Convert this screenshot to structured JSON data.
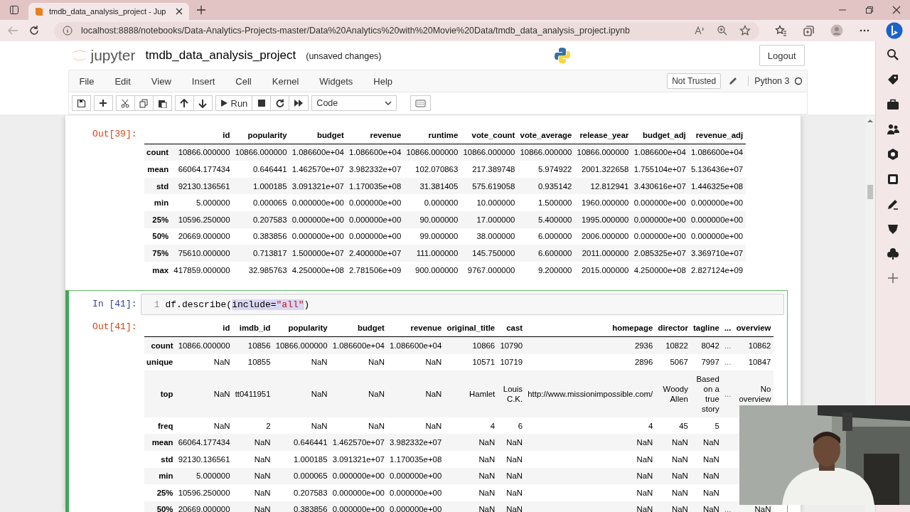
{
  "browser": {
    "tab_title": "tmdb_data_analysis_project - Jup",
    "url": "localhost:8888/notebooks/Data-Analytics-Projects-master/Data%20Analytics%20with%20Movie%20Data/tmdb_data_analysis_project.ipynb"
  },
  "notebook": {
    "brand": "jupyter",
    "title": "tmdb_data_analysis_project",
    "status": "(unsaved changes)",
    "logout": "Logout"
  },
  "menu": [
    "File",
    "Edit",
    "View",
    "Insert",
    "Cell",
    "Kernel",
    "Widgets",
    "Help"
  ],
  "trust": "Not Trusted",
  "kernel": "Python 3",
  "toolbar": {
    "run": "Run",
    "cell_type": "Code"
  },
  "cells": [
    {
      "selected": false,
      "prompt_out": "Out[39]:",
      "table": {
        "columns": [
          {
            "label": "id",
            "kind": "data"
          },
          {
            "label": "popularity",
            "kind": "data"
          },
          {
            "label": "budget",
            "kind": "data"
          },
          {
            "label": "revenue",
            "kind": "data"
          },
          {
            "label": "runtime",
            "kind": "data"
          },
          {
            "label": "vote_count",
            "kind": "data"
          },
          {
            "label": "vote_average",
            "kind": "data"
          },
          {
            "label": "release_year",
            "kind": "data"
          },
          {
            "label": "budget_adj",
            "kind": "data"
          },
          {
            "label": "revenue_adj",
            "kind": "data"
          }
        ],
        "rows": [
          {
            "label": "count",
            "values": [
              "10866.000000",
              "10866.000000",
              "1.086600e+04",
              "1.086600e+04",
              "10866.000000",
              "10866.000000",
              "10866.000000",
              "10866.000000",
              "1.086600e+04",
              "1.086600e+04"
            ]
          },
          {
            "label": "mean",
            "values": [
              "66064.177434",
              "0.646441",
              "1.462570e+07",
              "3.982332e+07",
              "102.070863",
              "217.389748",
              "5.974922",
              "2001.322658",
              "1.755104e+07",
              "5.136436e+07"
            ]
          },
          {
            "label": "std",
            "values": [
              "92130.136561",
              "1.000185",
              "3.091321e+07",
              "1.170035e+08",
              "31.381405",
              "575.619058",
              "0.935142",
              "12.812941",
              "3.430616e+07",
              "1.446325e+08"
            ]
          },
          {
            "label": "min",
            "values": [
              "5.000000",
              "0.000065",
              "0.000000e+00",
              "0.000000e+00",
              "0.000000",
              "10.000000",
              "1.500000",
              "1960.000000",
              "0.000000e+00",
              "0.000000e+00"
            ]
          },
          {
            "label": "25%",
            "values": [
              "10596.250000",
              "0.207583",
              "0.000000e+00",
              "0.000000e+00",
              "90.000000",
              "17.000000",
              "5.400000",
              "1995.000000",
              "0.000000e+00",
              "0.000000e+00"
            ]
          },
          {
            "label": "50%",
            "values": [
              "20669.000000",
              "0.383856",
              "0.000000e+00",
              "0.000000e+00",
              "99.000000",
              "38.000000",
              "6.000000",
              "2006.000000",
              "0.000000e+00",
              "0.000000e+00"
            ]
          },
          {
            "label": "75%",
            "values": [
              "75610.000000",
              "0.713817",
              "1.500000e+07",
              "2.400000e+07",
              "111.000000",
              "145.750000",
              "6.600000",
              "2011.000000",
              "2.085325e+07",
              "3.369710e+07"
            ]
          },
          {
            "label": "max",
            "values": [
              "417859.000000",
              "32.985763",
              "4.250000e+08",
              "2.781506e+09",
              "900.000000",
              "9767.000000",
              "9.200000",
              "2015.000000",
              "4.250000e+08",
              "2.827124e+09"
            ]
          }
        ]
      }
    },
    {
      "selected": true,
      "prompt_in": "In [41]:",
      "line_number": "1",
      "code": [
        {
          "text": "df.describe(",
          "kind": "plain",
          "selected": false
        },
        {
          "text": "include=",
          "kind": "plain",
          "selected": true
        },
        {
          "text": "\"all\"",
          "kind": "string",
          "selected": true
        },
        {
          "text": ")",
          "kind": "plain",
          "selected": false
        }
      ],
      "prompt_out": "Out[41]:",
      "table": {
        "columns": [
          {
            "label": "id",
            "kind": "data"
          },
          {
            "label": "imdb_id",
            "kind": "data"
          },
          {
            "label": "popularity",
            "kind": "data"
          },
          {
            "label": "budget",
            "kind": "data"
          },
          {
            "label": "revenue",
            "kind": "data"
          },
          {
            "label": "original_title",
            "kind": "data"
          },
          {
            "label": "cast",
            "kind": "data"
          },
          {
            "label": "homepage",
            "kind": "data"
          },
          {
            "label": "director",
            "kind": "data"
          },
          {
            "label": "tagline",
            "kind": "data"
          },
          {
            "label": "...",
            "kind": "ellipsis"
          },
          {
            "label": "overview",
            "kind": "data"
          }
        ],
        "rows": [
          {
            "label": "count",
            "values": [
              "10866.000000",
              "10856",
              "10866.000000",
              "1.086600e+04",
              "1.086600e+04",
              "10866",
              "10790",
              "2936",
              "10822",
              "8042",
              "...",
              "10862"
            ]
          },
          {
            "label": "unique",
            "values": [
              "NaN",
              "10855",
              "NaN",
              "NaN",
              "NaN",
              "10571",
              "10719",
              "2896",
              "5067",
              "7997",
              "...",
              "10847"
            ]
          },
          {
            "label": "top",
            "values": [
              "NaN",
              "tt0411951",
              "NaN",
              "NaN",
              "NaN",
              "Hamlet",
              "Louis C.K.",
              "http://www.missionimpossible.com/",
              "Woody Allen",
              "Based on a true story",
              "...",
              "No overview"
            ]
          },
          {
            "label": "freq",
            "values": [
              "NaN",
              "2",
              "NaN",
              "NaN",
              "NaN",
              "4",
              "6",
              "4",
              "45",
              "5"
            ]
          },
          {
            "label": "mean",
            "values": [
              "66064.177434",
              "NaN",
              "0.646441",
              "1.462570e+07",
              "3.982332e+07",
              "NaN",
              "NaN",
              "NaN",
              "NaN",
              "NaN"
            ]
          },
          {
            "label": "std",
            "values": [
              "92130.136561",
              "NaN",
              "1.000185",
              "3.091321e+07",
              "1.170035e+08",
              "NaN",
              "NaN",
              "NaN",
              "NaN",
              "NaN"
            ]
          },
          {
            "label": "min",
            "values": [
              "5.000000",
              "NaN",
              "0.000065",
              "0.000000e+00",
              "0.000000e+00",
              "NaN",
              "NaN",
              "NaN",
              "NaN",
              "NaN"
            ]
          },
          {
            "label": "25%",
            "values": [
              "10596.250000",
              "NaN",
              "0.207583",
              "0.000000e+00",
              "0.000000e+00",
              "NaN",
              "NaN",
              "NaN",
              "NaN",
              "NaN"
            ]
          },
          {
            "label": "50%",
            "values": [
              "20669.000000",
              "NaN",
              "0.383856",
              "0.000000e+00",
              "0.000000e+00",
              "NaN",
              "NaN",
              "NaN",
              "NaN",
              "NaN",
              "...",
              "NaN"
            ]
          }
        ]
      }
    }
  ],
  "webcam": {
    "kind": "picture"
  }
}
